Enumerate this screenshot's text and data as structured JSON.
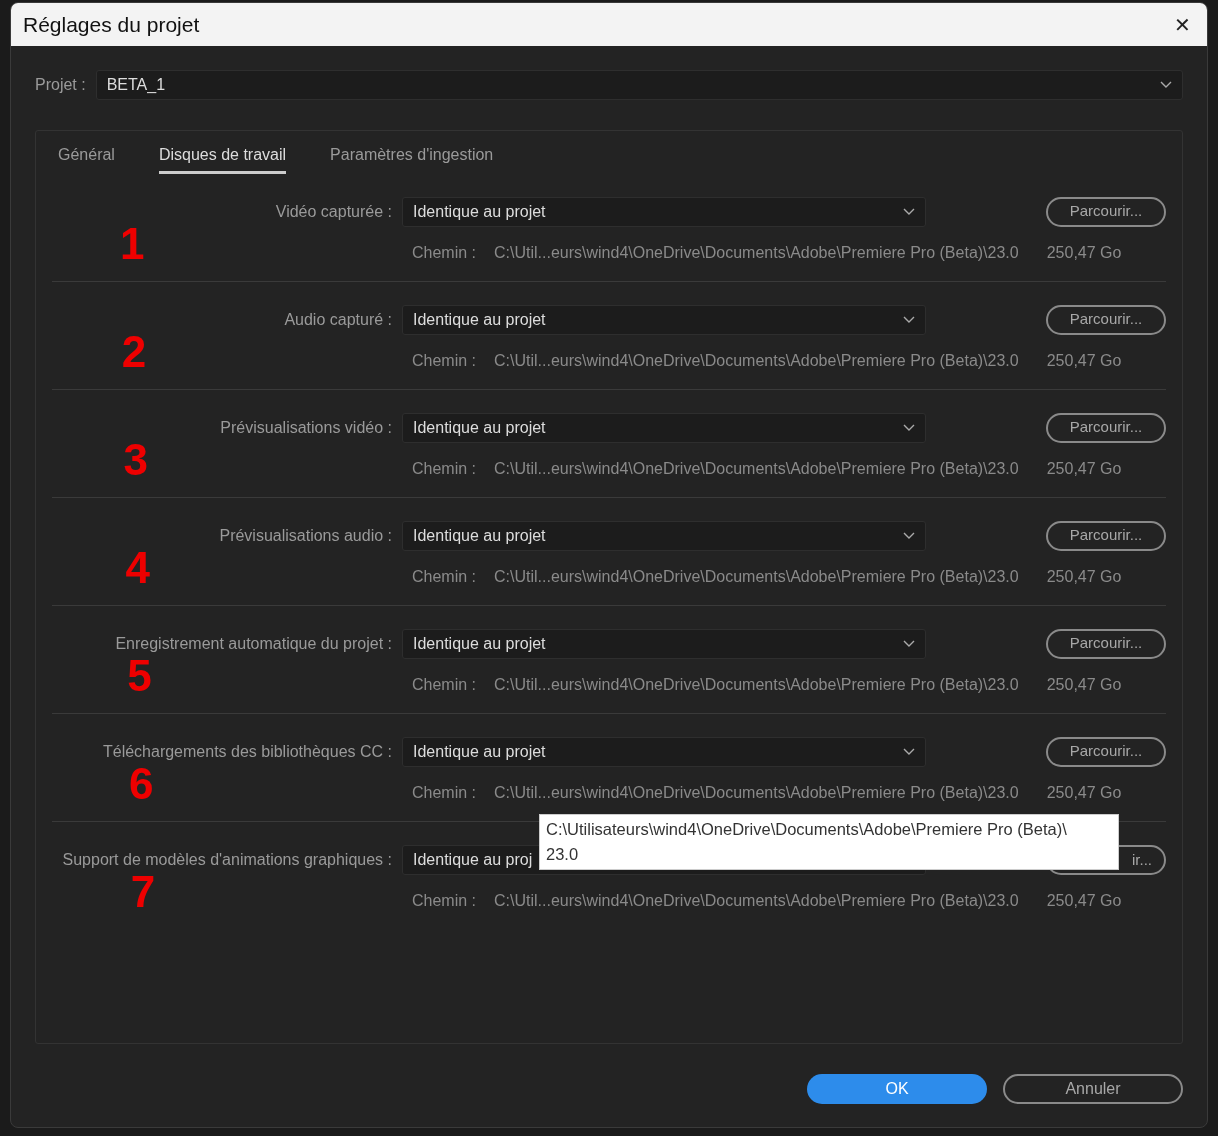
{
  "window": {
    "title": "Réglages du projet",
    "close": "✕"
  },
  "project": {
    "label": "Projet :",
    "value": "BETA_1"
  },
  "tabs": [
    {
      "label": "Général",
      "selected": false
    },
    {
      "label": "Disques de travail",
      "selected": true
    },
    {
      "label": "Paramètres d'ingestion",
      "selected": false
    }
  ],
  "rows": [
    {
      "label": "Vidéo capturée :",
      "marker": "1",
      "value": "Identique au projet",
      "browse": "Parcourir...",
      "path_label": "Chemin :",
      "path": "C:\\Util...eurs\\wind4\\OneDrive\\Documents\\Adobe\\Premiere Pro (Beta)\\23.0",
      "space": "250,47 Go"
    },
    {
      "label": "Audio capturé :",
      "marker": "2",
      "value": "Identique au projet",
      "browse": "Parcourir...",
      "path_label": "Chemin :",
      "path": "C:\\Util...eurs\\wind4\\OneDrive\\Documents\\Adobe\\Premiere Pro (Beta)\\23.0",
      "space": "250,47 Go"
    },
    {
      "label": "Prévisualisations vidéo :",
      "marker": "3",
      "value": "Identique au projet",
      "browse": "Parcourir...",
      "path_label": "Chemin :",
      "path": "C:\\Util...eurs\\wind4\\OneDrive\\Documents\\Adobe\\Premiere Pro (Beta)\\23.0",
      "space": "250,47 Go"
    },
    {
      "label": "Prévisualisations audio :",
      "marker": "4",
      "value": "Identique au projet",
      "browse": "Parcourir...",
      "path_label": "Chemin :",
      "path": "C:\\Util...eurs\\wind4\\OneDrive\\Documents\\Adobe\\Premiere Pro (Beta)\\23.0",
      "space": "250,47 Go"
    },
    {
      "label": "Enregistrement automatique du projet :",
      "marker": "5",
      "value": "Identique au projet",
      "browse": "Parcourir...",
      "path_label": "Chemin :",
      "path": "C:\\Util...eurs\\wind4\\OneDrive\\Documents\\Adobe\\Premiere Pro (Beta)\\23.0",
      "space": "250,47 Go"
    },
    {
      "label": "Téléchargements des bibliothèques CC :",
      "marker": "6",
      "value": "Identique au projet",
      "browse": "Parcourir...",
      "path_label": "Chemin :",
      "path": "C:\\Util...eurs\\wind4\\OneDrive\\Documents\\Adobe\\Premiere Pro (Beta)\\23.0",
      "space": "250,47 Go"
    },
    {
      "label": "Support de modèles d'animations graphiques :",
      "marker": "7",
      "value": "Identique au proj",
      "tooltip": {
        "lines": [
          "C:\\Utilisateurs\\wind4\\OneDrive\\Documents\\Adobe\\Premiere Pro (Beta)\\",
          "23.0"
        ]
      },
      "browse": "ir...",
      "path_label": "Chemin :",
      "path": "C:\\Util...eurs\\wind4\\OneDrive\\Documents\\Adobe\\Premiere Pro (Beta)\\23.0",
      "space": "250,47 Go"
    }
  ],
  "buttons": [
    {
      "label": "OK",
      "kind": "primary"
    },
    {
      "label": "Annuler",
      "kind": "secondary"
    }
  ]
}
